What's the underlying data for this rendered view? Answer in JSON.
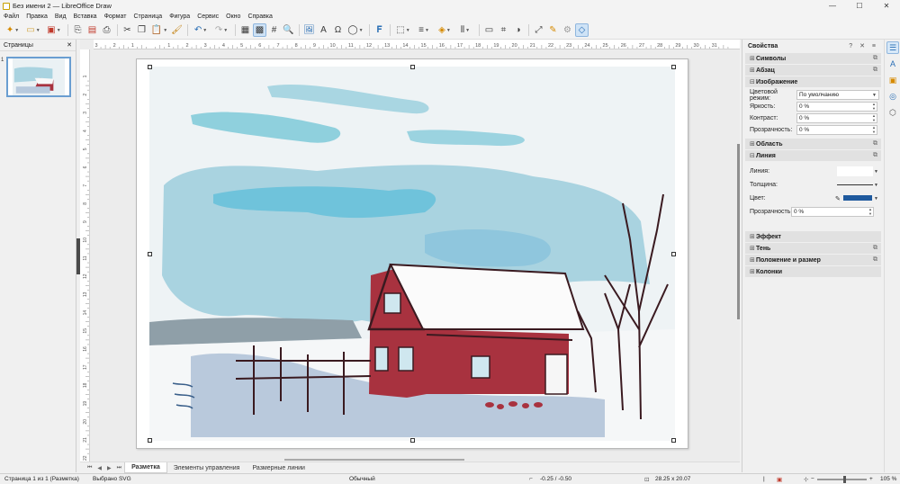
{
  "window": {
    "title": "Без имени 2 — LibreOffice Draw",
    "controls": [
      "—",
      "☐",
      "✕"
    ]
  },
  "menu": [
    "Файл",
    "Правка",
    "Вид",
    "Вставка",
    "Формат",
    "Страница",
    "Фигура",
    "Сервис",
    "Окно",
    "Справка"
  ],
  "pages_panel": {
    "title": "Страницы",
    "close": "✕",
    "page_number": "1"
  },
  "sheet_tabs": {
    "nav": [
      "⏮",
      "◀",
      "▶",
      "⏭"
    ],
    "tabs": [
      "Разметка",
      "Элементы управления",
      "Размерные линии"
    ],
    "active": "Разметка"
  },
  "sidebar": {
    "title": "Свойства",
    "header_controls": "? ✕ ≡",
    "sections": {
      "symbols": "Символы",
      "paragraph": "Абзац",
      "image": "Изображение",
      "area": "Область",
      "line": "Линия",
      "effect": "Эффект",
      "shadow": "Тень",
      "position_size": "Положение и размер",
      "columns": "Колонки"
    },
    "image_props": {
      "color_mode_label": "Цветовой режим:",
      "color_mode_value": "По умолчанию",
      "brightness_label": "Яркость:",
      "brightness_value": "0 %",
      "contrast_label": "Контраст:",
      "contrast_value": "0 %",
      "transparency_label": "Прозрачность:",
      "transparency_value": "0 %"
    },
    "line_props": {
      "line_label": "Линия:",
      "width_label": "Толщина:",
      "color_label": "Цвет:",
      "color_value": "#1f5a9e",
      "transparency_label": "Прозрачность:",
      "transparency_value": "0 %"
    }
  },
  "status": {
    "page": "Страница 1 из 1 (Разметка)",
    "selection": "Выбрано SVG",
    "style": "Обычный",
    "position": "-0.25 / -0.50",
    "size": "28.25 x 20.07",
    "zoom": "105 %"
  },
  "ruler_h_labels": [
    "3",
    "2",
    "1",
    "",
    "1",
    "2",
    "3",
    "4",
    "5",
    "6",
    "7",
    "8",
    "9",
    "10",
    "11",
    "12",
    "13",
    "14",
    "15",
    "16",
    "17",
    "18",
    "19",
    "20",
    "21",
    "22",
    "23",
    "24",
    "25",
    "26",
    "27",
    "28",
    "29",
    "30",
    "31"
  ],
  "ruler_v_labels": [
    "1",
    "2",
    "3",
    "4",
    "5",
    "6",
    "7",
    "8",
    "9",
    "10",
    "11",
    "12",
    "13",
    "14",
    "15",
    "16",
    "17",
    "18",
    "19",
    "20",
    "21",
    "22"
  ],
  "colors": {
    "accent": "#2a6fb5",
    "barn_red": "#a8323f",
    "sky_blue": "#9cd1de"
  }
}
